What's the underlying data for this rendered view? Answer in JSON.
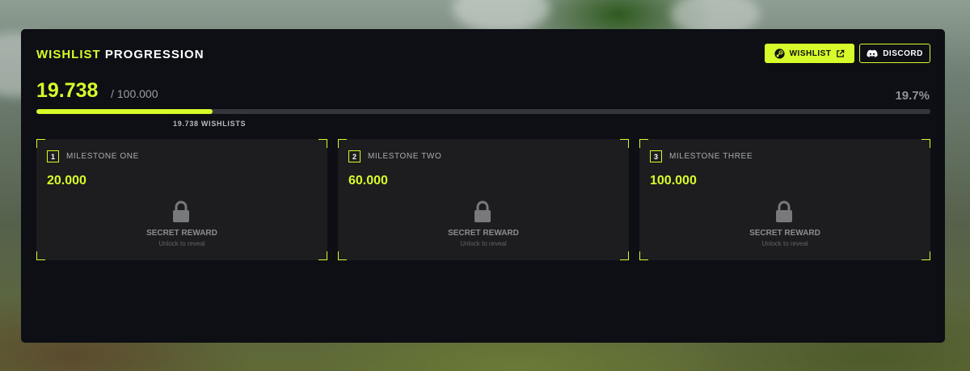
{
  "header": {
    "title_accent": "WISHLIST",
    "title_rest": "PROGRESSION",
    "wishlist_button": "WISHLIST",
    "discord_button": "DISCORD"
  },
  "progress": {
    "current": "19.738",
    "goal": "100.000",
    "percent_label": "19.7%",
    "fraction": 0.197,
    "bar_label": "19.738 WISHLISTS"
  },
  "milestones": [
    {
      "number": "1",
      "name": "MILESTONE ONE",
      "value": "20.000",
      "reward": "SECRET REWARD",
      "reward_hint": "Unlock to reveal"
    },
    {
      "number": "2",
      "name": "MILESTONE TWO",
      "value": "60.000",
      "reward": "SECRET REWARD",
      "reward_hint": "Unlock to reveal"
    },
    {
      "number": "3",
      "name": "MILESTONE THREE",
      "value": "100.000",
      "reward": "SECRET REWARD",
      "reward_hint": "Unlock to reveal"
    }
  ],
  "icons": {
    "wishlist_brand": "steam-icon",
    "external": "external-link-icon",
    "discord": "discord-icon",
    "locked": "lock-icon"
  },
  "colors": {
    "accent": "#d7fb2a",
    "panel_bg": "#0d0f14",
    "card_bg": "#1d1d1f"
  }
}
